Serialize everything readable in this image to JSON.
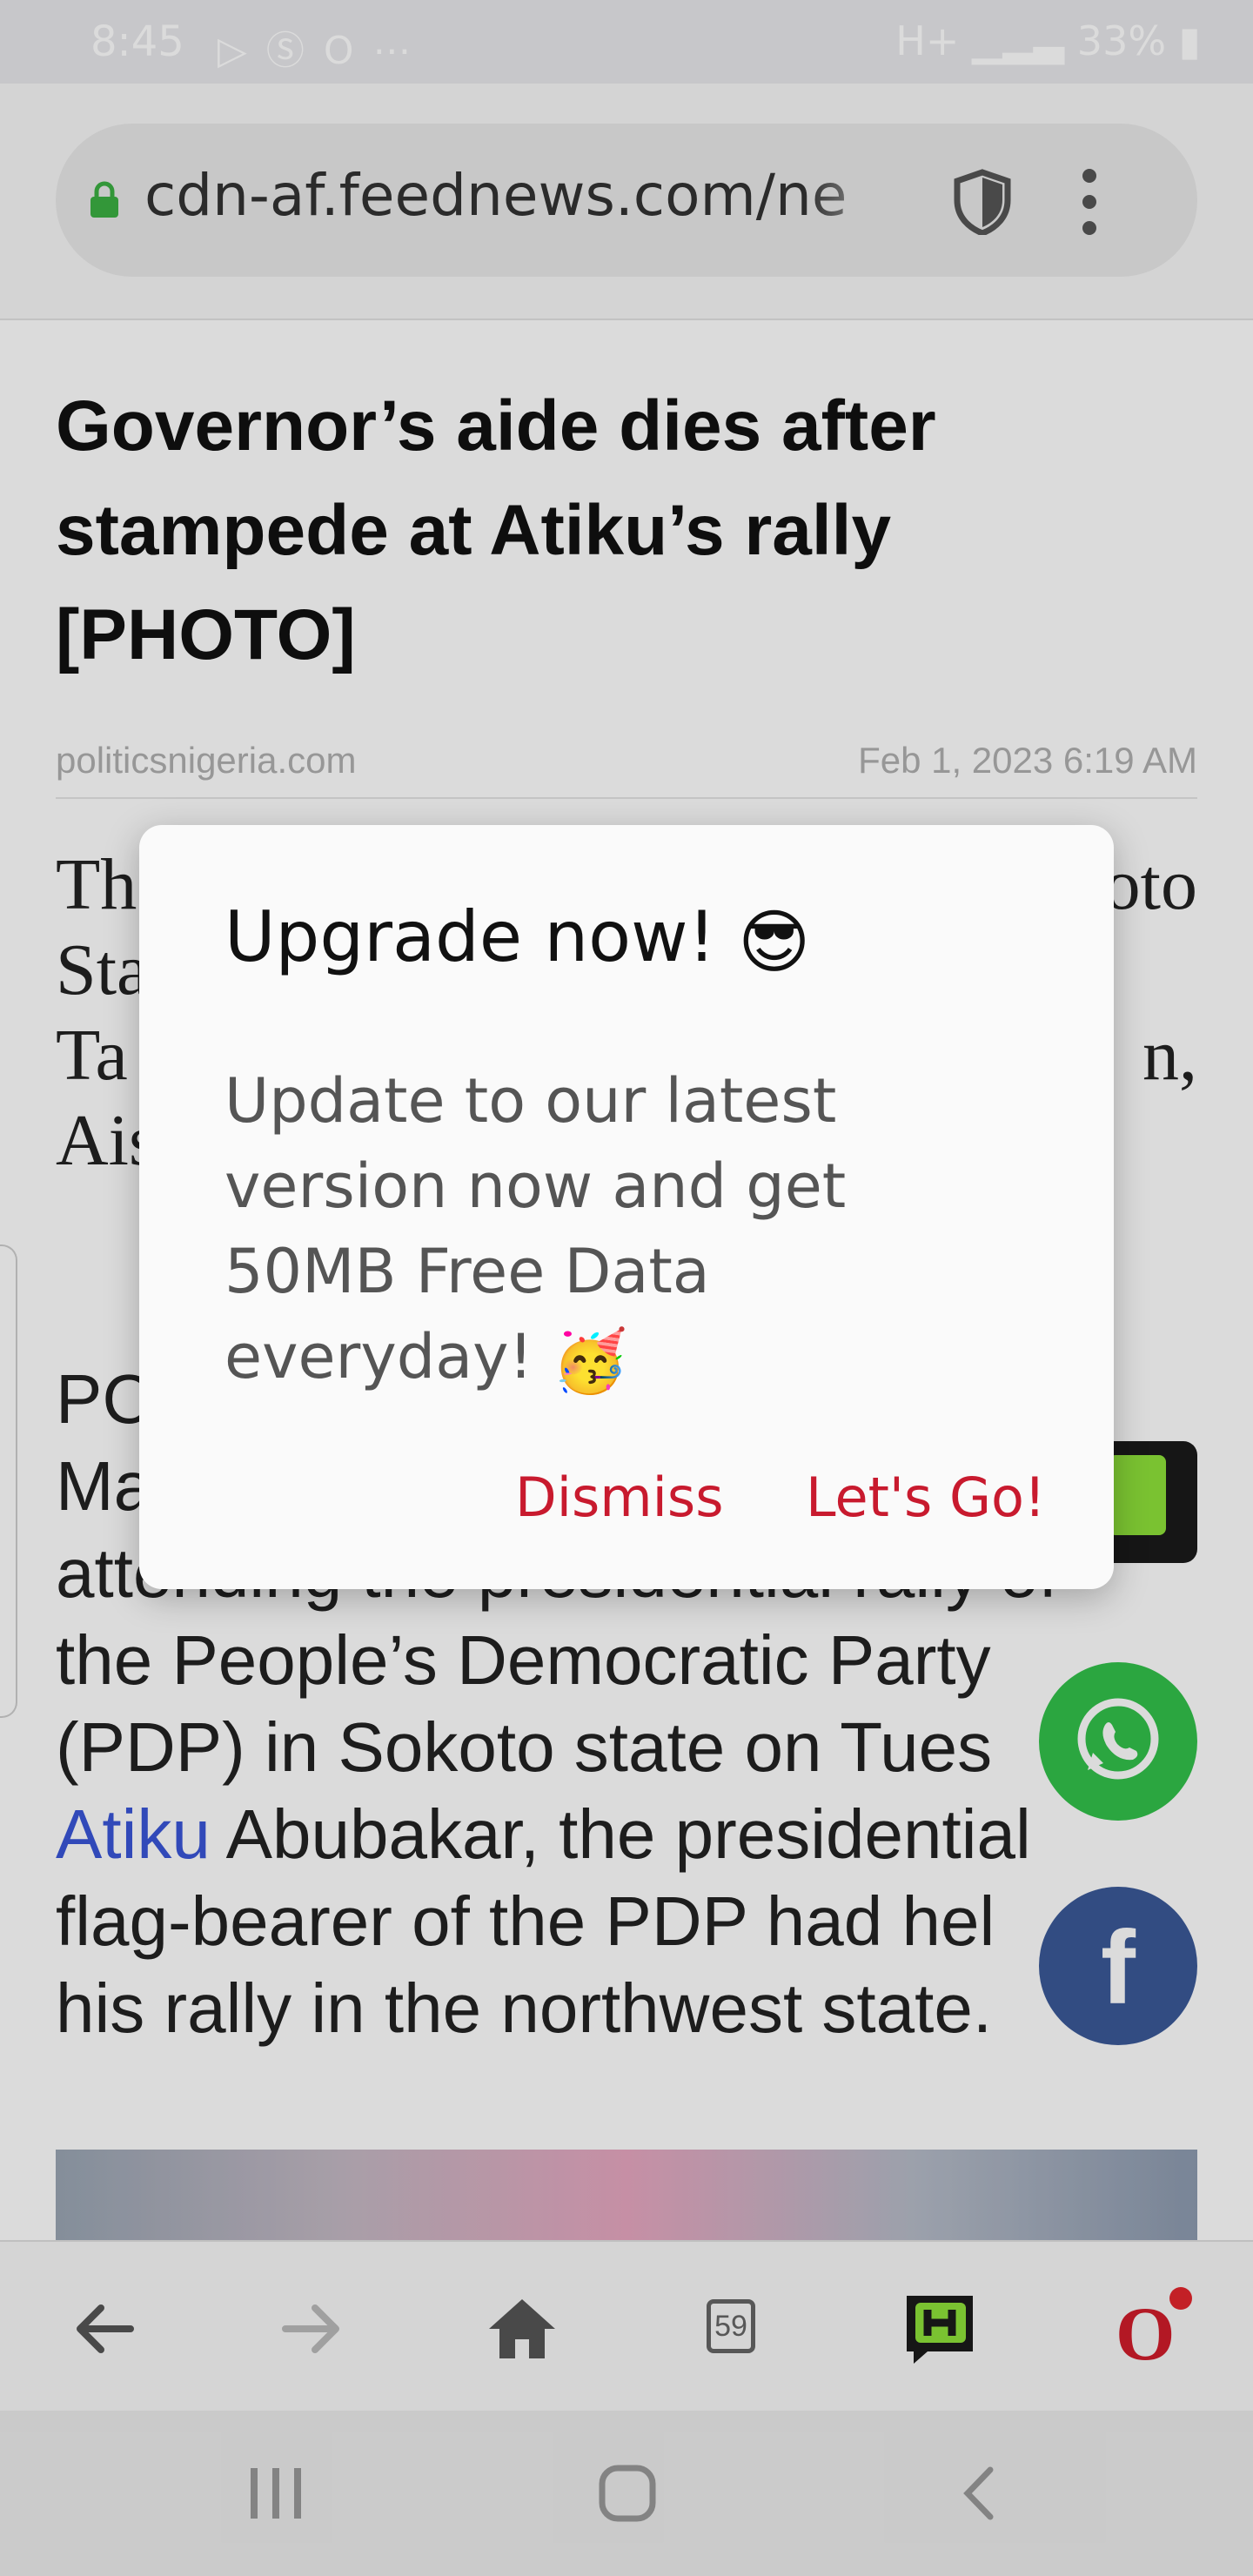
{
  "status_bar": {
    "time": "8:45",
    "left_icons": [
      "play-store-icon",
      "s-icon",
      "opera-icon",
      "more-dots"
    ],
    "network": "H+",
    "battery": "33%"
  },
  "browser": {
    "url": "cdn-af.feednews.com/ne",
    "shield_icon": "shield-icon",
    "menu_icon": "kebab-menu-icon"
  },
  "article": {
    "headline": "Governor’s aide dies after stampede at Atiku’s rally [PHOTO]",
    "source": "politicsnigeria.com",
    "date": "Feb 1, 2023 6:19 AM",
    "serif_lines": [
      {
        "left": "Th",
        "right": "oto"
      },
      {
        "left": "Sta",
        "right": ""
      },
      {
        "left": "Ta",
        "right": "n,"
      },
      {
        "left": "Ais",
        "right": ""
      }
    ],
    "para_lines": [
      "PC",
      "Ma",
      "attending the presidential rally of",
      "the People’s Democratic Party",
      "(PDP) in Sokoto state on Tues",
      "Abubakar, the presidential",
      "flag-bearer of the PDP had hel",
      "his rally in the northwest state."
    ],
    "link_text": "Atiku"
  },
  "dialog": {
    "title": "Upgrade now!",
    "title_emoji": "😎",
    "body": "Update to our latest version now and get 50MB Free Data everyday!",
    "body_emoji": "🥳",
    "dismiss_label": "Dismiss",
    "go_label": "Let's Go!"
  },
  "toolbar": {
    "tab_count": "59",
    "items": [
      "back-icon",
      "forward-icon",
      "home-icon",
      "tabs-icon",
      "hype-icon",
      "opera-menu-icon"
    ]
  },
  "colors": {
    "accent_red": "#c81a2e",
    "whatsapp_green": "#33c24b",
    "facebook_blue": "#3b5998",
    "link_blue": "#3a56d8"
  }
}
